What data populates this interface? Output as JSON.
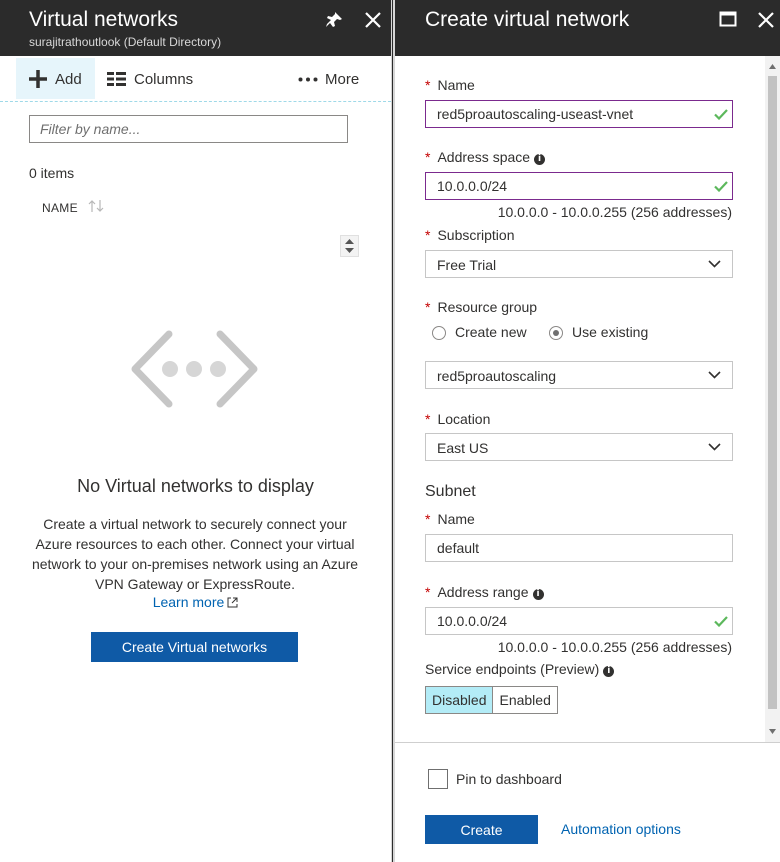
{
  "left_blade": {
    "title": "Virtual networks",
    "subtitle": "surajitrathoutlook (Default Directory)",
    "toolbar": {
      "add_label": "Add",
      "columns_label": "Columns",
      "more_label": "More"
    },
    "filter_placeholder": "Filter by name...",
    "items_count": "0 items",
    "column_name": "NAME",
    "empty_title": "No Virtual networks to display",
    "empty_description": "Create a virtual network to securely connect your Azure resources to each other. Connect your virtual network to your on-premises network using an Azure VPN Gateway or ExpressRoute.",
    "learn_more": "Learn more",
    "create_button": "Create Virtual networks"
  },
  "right_blade": {
    "title": "Create virtual network",
    "required_mark": "*",
    "name": {
      "label": "Name",
      "value": "red5proautoscaling-useast-vnet"
    },
    "address_space": {
      "label": "Address space",
      "value": "10.0.0.0/24",
      "hint": "10.0.0.0 - 10.0.0.255 (256 addresses)"
    },
    "subscription": {
      "label": "Subscription",
      "value": "Free Trial"
    },
    "resource_group": {
      "label": "Resource group",
      "option_new": "Create new",
      "option_existing": "Use existing",
      "selected": "Use existing",
      "value": "red5proautoscaling"
    },
    "location": {
      "label": "Location",
      "value": "East US"
    },
    "subnet": {
      "heading": "Subnet",
      "name_label": "Name",
      "name_value": "default",
      "range_label": "Address range",
      "range_value": "10.0.0.0/24",
      "range_hint": "10.0.0.0 - 10.0.0.255 (256 addresses)"
    },
    "service_endpoints": {
      "label": "Service endpoints (Preview)",
      "options": [
        "Disabled",
        "Enabled"
      ],
      "selected": "Disabled"
    },
    "footer": {
      "pin_label": "Pin to dashboard",
      "create_label": "Create",
      "automation_label": "Automation options"
    }
  },
  "colors": {
    "header_bg": "#2b2b2b",
    "primary_button": "#0f5aa6",
    "link": "#0063b1",
    "required": "#c40000",
    "valid_check": "#5cb85c",
    "selected_toggle": "#b3ecf7"
  }
}
